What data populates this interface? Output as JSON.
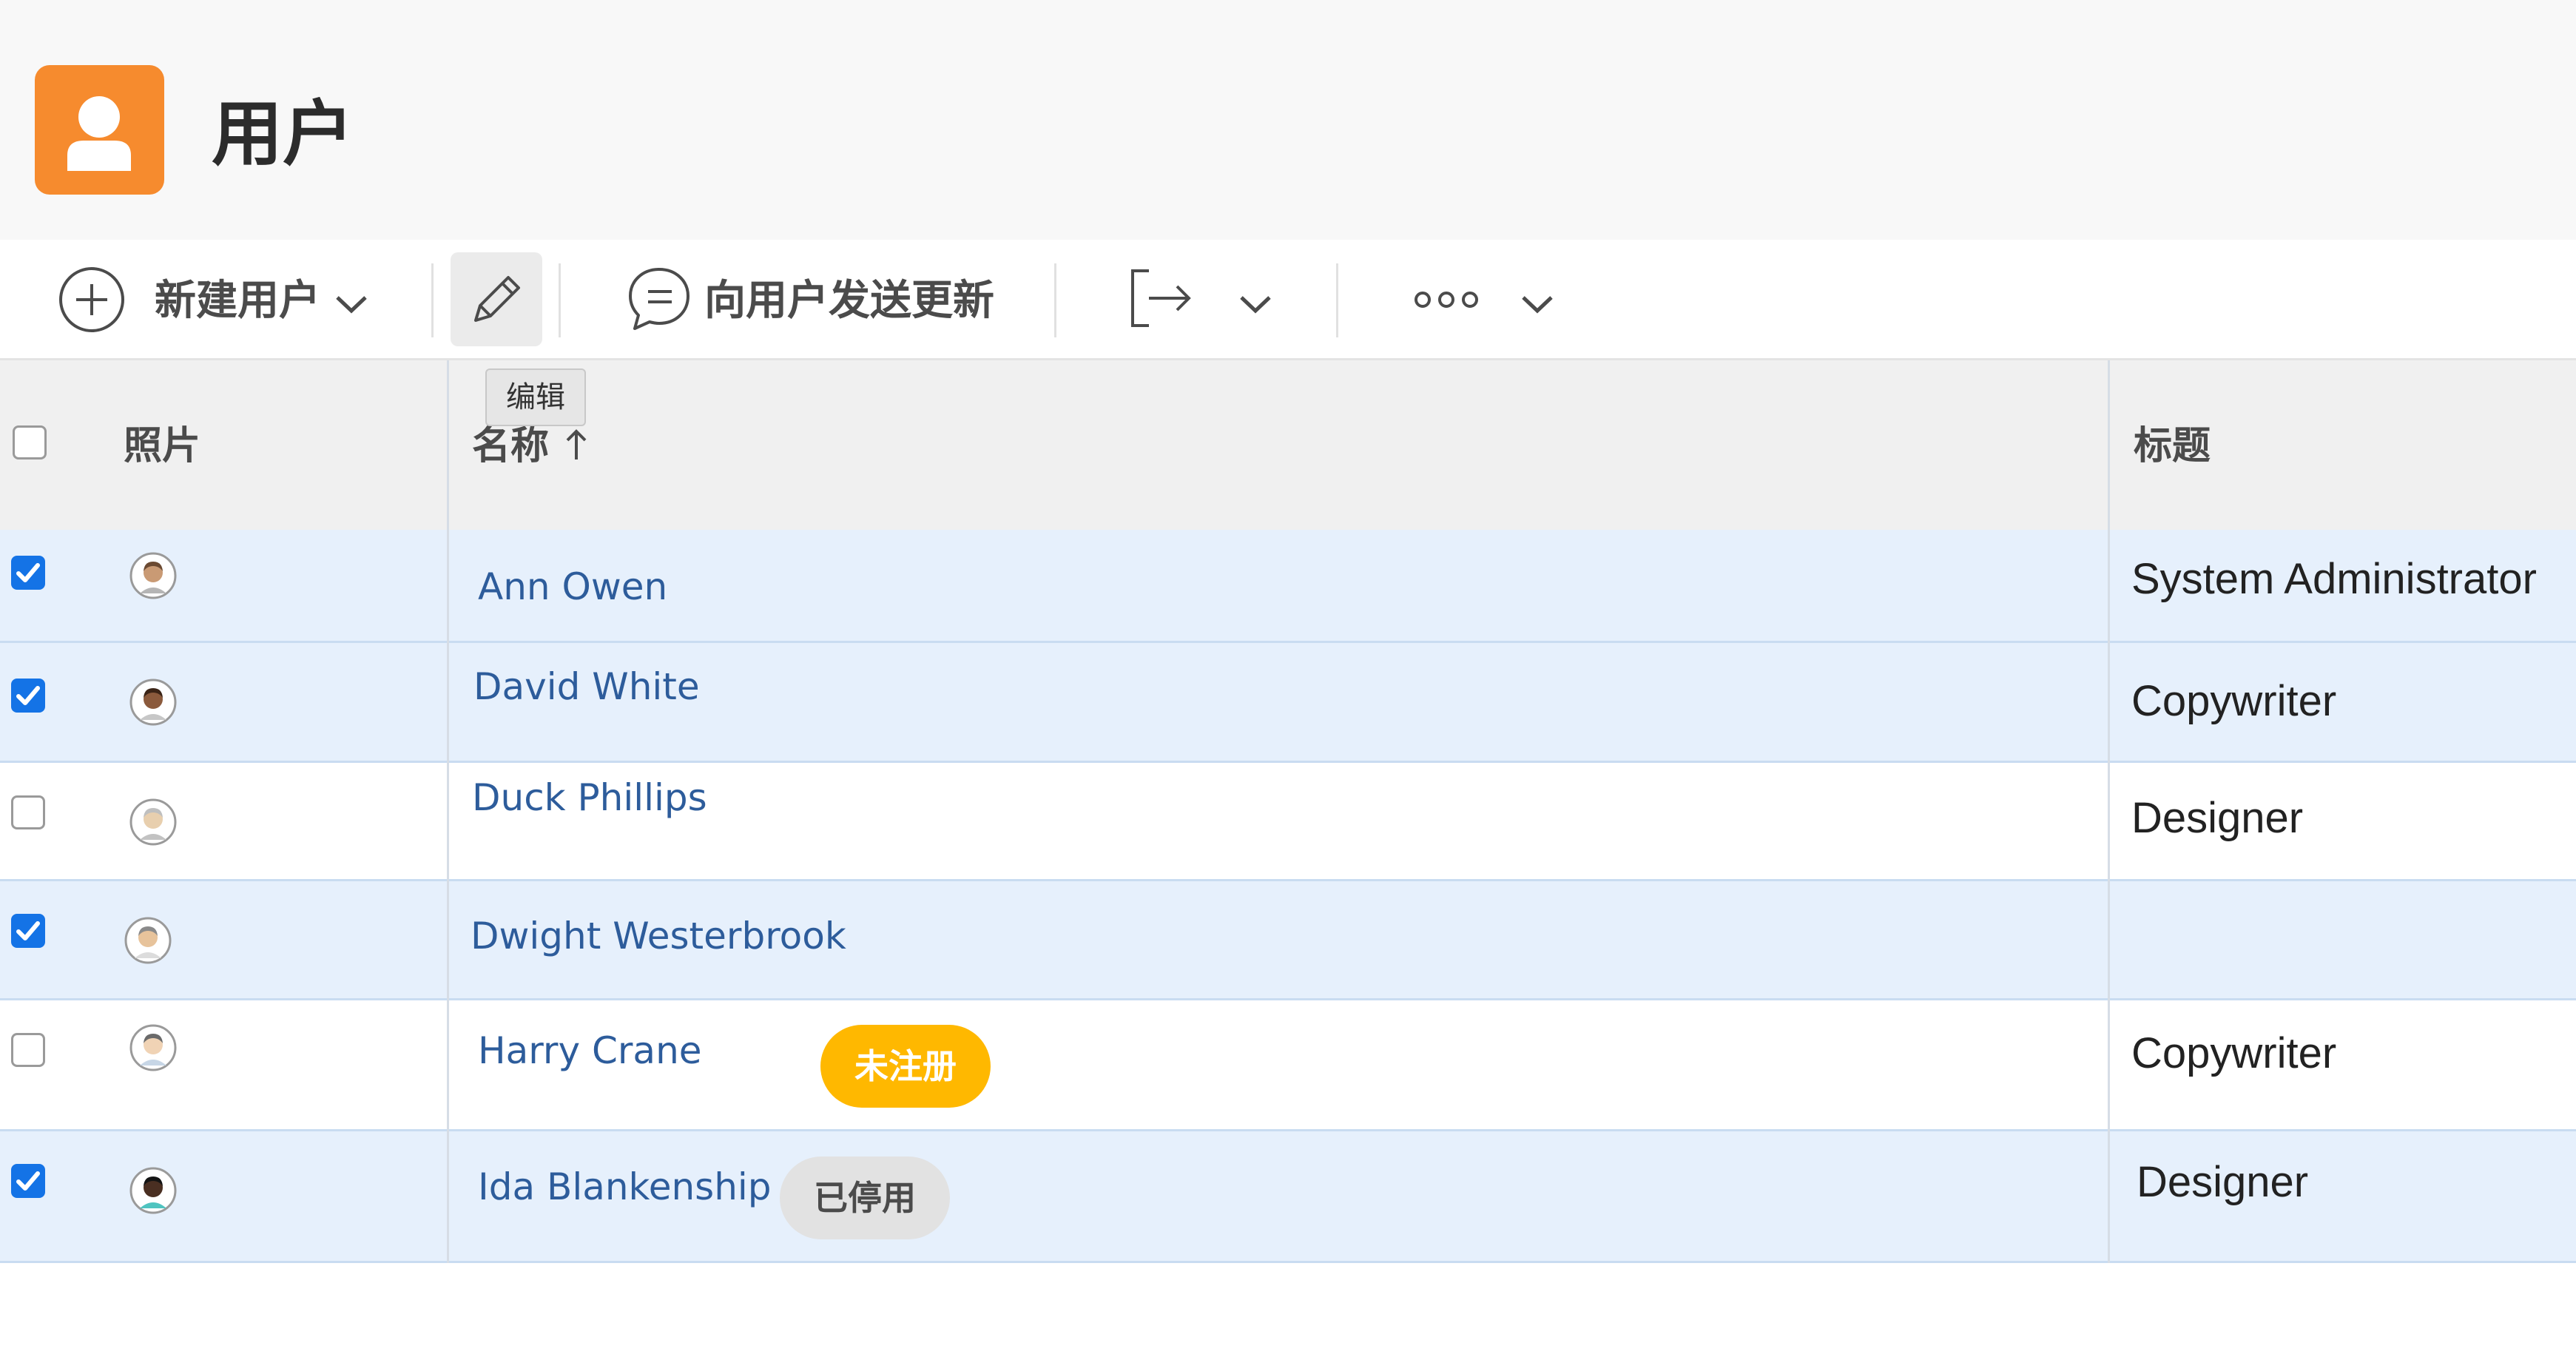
{
  "header": {
    "title": "用户",
    "icon": "user-icon",
    "icon_color": "#f68b2e"
  },
  "toolbar": {
    "new_user_label": "新建用户",
    "edit_tooltip": "编辑",
    "send_update_label": "向用户发送更新"
  },
  "table": {
    "columns": [
      "照片",
      "名称",
      "标题"
    ],
    "sorted_column": "名称",
    "sort_direction": "ascending",
    "rows": [
      {
        "checked": true,
        "name": "Ann Owen",
        "title": "System Administrator",
        "badge": ""
      },
      {
        "checked": true,
        "name": "David White",
        "title": "Copywriter",
        "badge": ""
      },
      {
        "checked": false,
        "name": "Duck Phillips",
        "title": "Designer",
        "badge": ""
      },
      {
        "checked": true,
        "name": "Dwight Westerbrook",
        "title": "",
        "badge": ""
      },
      {
        "checked": false,
        "name": "Harry Crane",
        "title": "Copywriter",
        "badge": "未注册"
      },
      {
        "checked": true,
        "name": "Ida Blankenship",
        "title": "Designer",
        "badge": "已停用"
      }
    ]
  },
  "colors": {
    "accent": "#1473e6",
    "link": "#2d5c9b",
    "selected_row": "#e6f0fc",
    "badge_unregistered": "#ffb800",
    "badge_disabled": "#e2e2e2"
  }
}
